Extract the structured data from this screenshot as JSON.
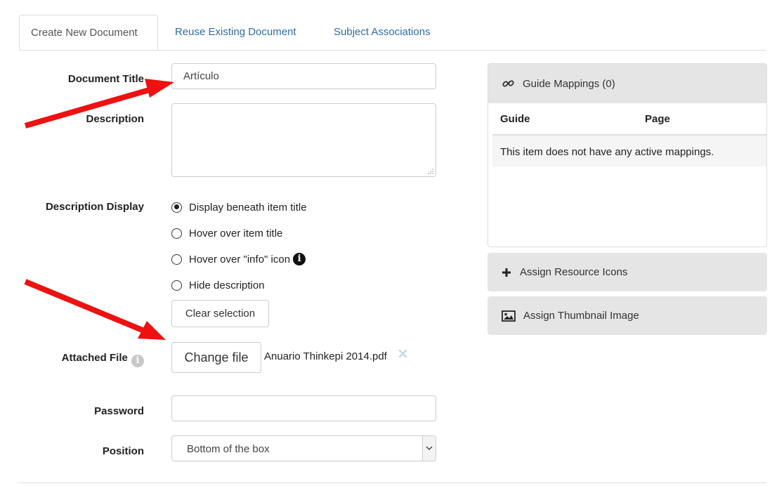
{
  "tabs": [
    {
      "label": "Create New Document",
      "active": true
    },
    {
      "label": "Reuse Existing Document",
      "active": false
    },
    {
      "label": "Subject Associations",
      "active": false
    }
  ],
  "form": {
    "title_label": "Document Title",
    "title_value": "Artículo",
    "description_label": "Description",
    "description_value": "",
    "display_label": "Description Display",
    "display_options": [
      {
        "label": "Display beneath item title",
        "checked": true
      },
      {
        "label": "Hover over item title",
        "checked": false
      },
      {
        "label": "Hover over \"info\" icon",
        "checked": false
      },
      {
        "label": "Hide description",
        "checked": false
      }
    ],
    "clear_label": "Clear selection",
    "attached_label": "Attached File",
    "change_file_label": "Change file",
    "file_name": "Anuario Thinkepi 2014.pdf",
    "password_label": "Password",
    "password_value": "",
    "position_label": "Position",
    "position_value": "Bottom of the box"
  },
  "guide_panel": {
    "title": "Guide Mappings (0)",
    "columns": [
      "Guide",
      "Page"
    ],
    "empty_message": "This item does not have any active mappings."
  },
  "resource_icons_label": "Assign Resource Icons",
  "thumbnail_label": "Assign Thumbnail Image",
  "icons": {
    "link": "link-icon",
    "plus": "plus-icon",
    "image": "image-icon",
    "info": "info-icon",
    "remove": "remove-file-icon",
    "chevron": "chevron-down-icon"
  },
  "colors": {
    "link": "#2e6da4",
    "panel_header": "#e5e5e5",
    "annotation_arrow": "#ee1111"
  }
}
